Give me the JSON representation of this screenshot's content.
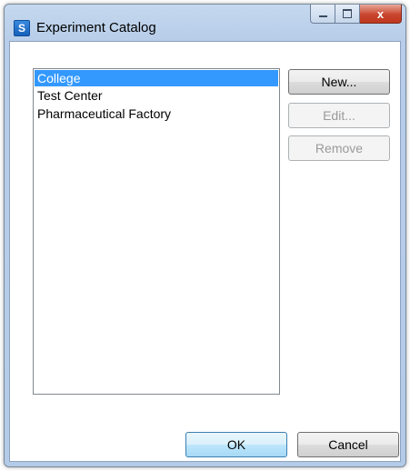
{
  "window": {
    "title": "Experiment Catalog",
    "icon": "app-icon",
    "icon_glyph": "S",
    "caption_buttons": {
      "minimize": "minimize-icon",
      "maximize": "maximize-icon",
      "close": "close-icon",
      "close_glyph": "x"
    }
  },
  "catalog": {
    "items": [
      {
        "label": "College",
        "selected": true
      },
      {
        "label": "Test Center",
        "selected": false
      },
      {
        "label": "Pharmaceutical Factory",
        "selected": false
      }
    ]
  },
  "actions": {
    "new_label": "New...",
    "edit_label": "Edit...",
    "remove_label": "Remove",
    "edit_enabled": false,
    "remove_enabled": false
  },
  "footer": {
    "ok_label": "OK",
    "cancel_label": "Cancel"
  },
  "colors": {
    "selection": "#3399ff",
    "title_gradient_top": "#c5d8ee",
    "close_button": "#c9462e"
  }
}
